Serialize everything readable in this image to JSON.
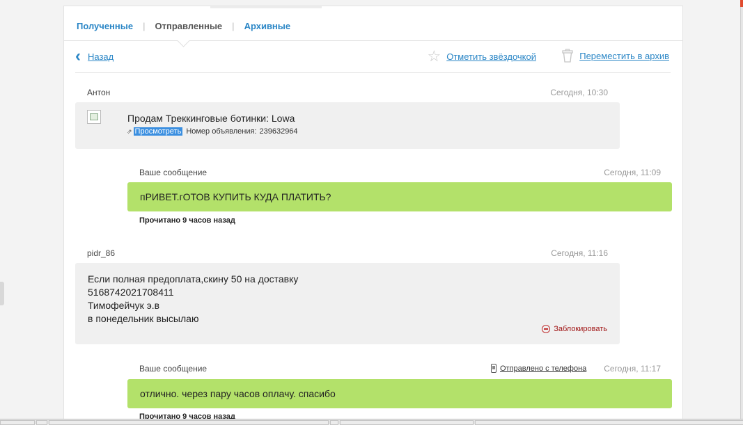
{
  "tabs": {
    "received": "Полученные",
    "sent": "Отправленные",
    "archive": "Архивные",
    "separator": "|"
  },
  "toolbar": {
    "back": "Назад",
    "star": "Отметить звёздочкой",
    "move_to_archive": "Переместить в архив"
  },
  "messages": [
    {
      "author": "Антон",
      "time": "Сегодня, 10:30",
      "ad_title": "Продам Треккинговые ботинки: Lowa",
      "view_link": "Просмотреть",
      "ad_number_label": "Номер объявления:",
      "ad_number": "239632964"
    },
    {
      "author": "Ваше сообщение",
      "time": "Сегодня, 11:09",
      "text": "пРИВЕТ.гОТОВ КУПИТЬ КУДА ПЛАТИТЬ?",
      "status": "Прочитано 9 часов назад"
    },
    {
      "author": "pidr_86",
      "time": "Сегодня, 11:16",
      "lines": [
        "Если полная предоплата,скину 50 на доставку",
        "5168742021708411",
        "Тимофейчук э.в",
        "в понедельник высылаю"
      ],
      "block": "Заблокировать"
    },
    {
      "author": "Ваше сообщение",
      "sent_from": "Отправлено с телефона",
      "time": "Сегодня, 11:17",
      "text": "отлично. через пару часов оплачу. спасибо",
      "status": "Прочитано 9 часов назад"
    }
  ],
  "colors": {
    "link": "#2a86c6",
    "own_bubble": "#b3e16a",
    "other_bubble": "#f0f0f0",
    "block": "#a01515"
  },
  "icons": [
    "back-chevron-icon",
    "star-icon",
    "trash-icon",
    "image-icon",
    "external-link-icon",
    "block-icon",
    "phone-icon"
  ]
}
